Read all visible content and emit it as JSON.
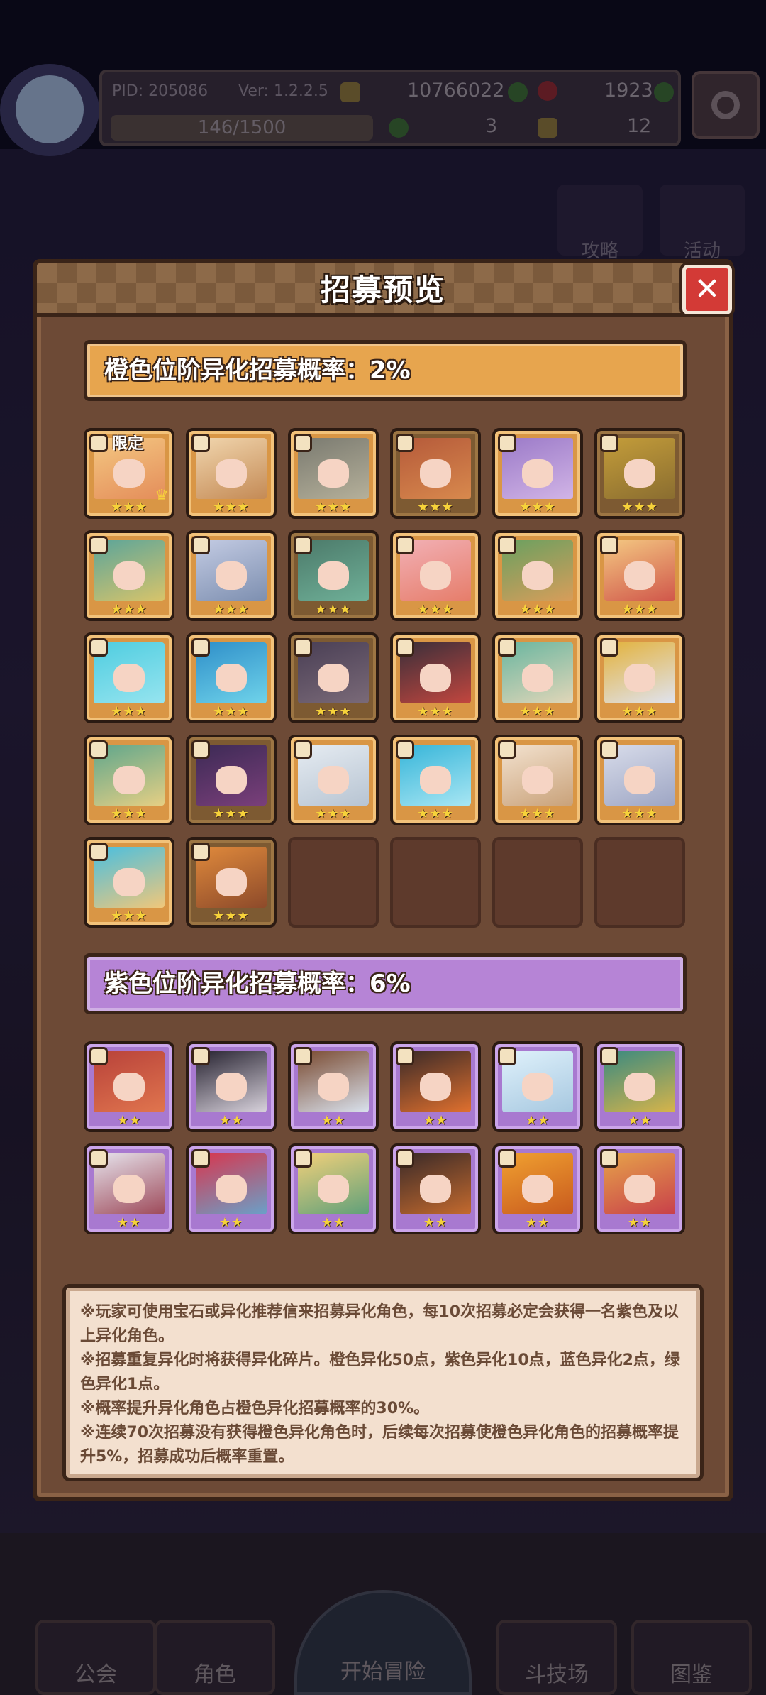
{
  "hud": {
    "pid": "PID: 205086",
    "version": "Ver: 1.2.2.5",
    "gold": "10766022",
    "gems": "1923",
    "xp": "146/1500",
    "clover": "3",
    "tickets": "12"
  },
  "side_buttons": [
    "攻略",
    "活动"
  ],
  "modal": {
    "title": "招募预览",
    "close_icon": "close-icon"
  },
  "orange_section": {
    "label": "橙色位阶异化招募概率：2%",
    "limited_badge": "限定",
    "heroes": [
      {
        "stars": "★★★",
        "active": true,
        "limited": true,
        "colors": [
          "#f4c882",
          "#e48d5a"
        ]
      },
      {
        "stars": "★★★",
        "active": true,
        "colors": [
          "#f1d6ae",
          "#c48a55"
        ]
      },
      {
        "stars": "★★★",
        "active": true,
        "colors": [
          "#7a7a70",
          "#b5b09a"
        ]
      },
      {
        "stars": "★★★",
        "active": false,
        "colors": [
          "#b55a3a",
          "#d8894d"
        ]
      },
      {
        "stars": "★★★",
        "active": true,
        "colors": [
          "#9b7ac8",
          "#d1b4e6"
        ]
      },
      {
        "stars": "★★★",
        "active": false,
        "colors": [
          "#c49d3a",
          "#8a6d30"
        ]
      },
      {
        "stars": "★★★",
        "active": true,
        "colors": [
          "#5ba59a",
          "#d8c46a"
        ]
      },
      {
        "stars": "★★★",
        "active": true,
        "colors": [
          "#c3cbe3",
          "#7d8fb0"
        ]
      },
      {
        "stars": "★★★",
        "active": false,
        "colors": [
          "#4c7a6a",
          "#6fb098"
        ]
      },
      {
        "stars": "★★★",
        "active": true,
        "colors": [
          "#f2b0b5",
          "#e67d6a"
        ]
      },
      {
        "stars": "★★★",
        "active": true,
        "colors": [
          "#6aa060",
          "#d89d5a"
        ]
      },
      {
        "stars": "★★★",
        "active": true,
        "colors": [
          "#f4c882",
          "#d0564a"
        ]
      },
      {
        "stars": "★★★",
        "active": true,
        "colors": [
          "#4fcde0",
          "#96e4ef"
        ]
      },
      {
        "stars": "★★★",
        "active": true,
        "colors": [
          "#2f8fc9",
          "#6fd3ea"
        ]
      },
      {
        "stars": "★★★",
        "active": false,
        "colors": [
          "#4a3f55",
          "#7a6a78"
        ]
      },
      {
        "stars": "★★★",
        "active": true,
        "colors": [
          "#3a2f3a",
          "#c2463e"
        ]
      },
      {
        "stars": "★★★",
        "active": true,
        "colors": [
          "#6ab6a0",
          "#e1d6b8"
        ]
      },
      {
        "stars": "★★★",
        "active": true,
        "colors": [
          "#e3b23c",
          "#dfe3f0"
        ]
      },
      {
        "stars": "★★★",
        "active": true,
        "colors": [
          "#5ea68c",
          "#e5cf84"
        ]
      },
      {
        "stars": "★★★",
        "active": false,
        "colors": [
          "#3c2a55",
          "#7a3f7a"
        ]
      },
      {
        "stars": "★★★",
        "active": true,
        "colors": [
          "#e6ecf2",
          "#b7c4d2"
        ]
      },
      {
        "stars": "★★★",
        "active": true,
        "colors": [
          "#36b5d9",
          "#a7e6f3"
        ]
      },
      {
        "stars": "★★★",
        "active": true,
        "colors": [
          "#f3e2cf",
          "#c9a27a"
        ]
      },
      {
        "stars": "★★★",
        "active": true,
        "colors": [
          "#d8dcea",
          "#9ea6c4"
        ]
      },
      {
        "stars": "★★★",
        "active": true,
        "colors": [
          "#49bfe0",
          "#f0c77a"
        ]
      },
      {
        "stars": "★★★",
        "active": false,
        "colors": [
          "#e08a3c",
          "#8d4a2a"
        ]
      }
    ],
    "empty_slots": 4
  },
  "purple_section": {
    "label": "紫色位阶异化招募概率：6%",
    "heroes": [
      {
        "stars": "★★",
        "colors": [
          "#b8423a",
          "#e0754e"
        ]
      },
      {
        "stars": "★★",
        "colors": [
          "#262230",
          "#d8d2dc"
        ]
      },
      {
        "stars": "★★",
        "colors": [
          "#7a4a30",
          "#d9e2ee"
        ]
      },
      {
        "stars": "★★",
        "colors": [
          "#3a2a28",
          "#e0702e"
        ]
      },
      {
        "stars": "★★",
        "colors": [
          "#dff1fb",
          "#a7c8e0"
        ]
      },
      {
        "stars": "★★",
        "colors": [
          "#3a8a80",
          "#d7b44a"
        ]
      },
      {
        "stars": "★★",
        "colors": [
          "#e6e3ec",
          "#9e4a5a"
        ]
      },
      {
        "stars": "★★",
        "colors": [
          "#d8364e",
          "#6aa0c8"
        ]
      },
      {
        "stars": "★★",
        "colors": [
          "#f2d07a",
          "#5fa07a"
        ]
      },
      {
        "stars": "★★",
        "colors": [
          "#3a2a28",
          "#c46a2e"
        ]
      },
      {
        "stars": "★★",
        "colors": [
          "#f0a030",
          "#c85a1e"
        ]
      },
      {
        "stars": "★★",
        "colors": [
          "#e6a24a",
          "#c8404a"
        ]
      }
    ]
  },
  "notes": [
    "※玩家可使用宝石或异化推荐信来招募异化角色，每10次招募必定会获得一名紫色及以",
    "上异化角色。",
    "※招募重复异化时将获得异化碎片。橙色异化50点，紫色异化10点，蓝色异化2点，绿",
    "色异化1点。",
    "※概率提升异化角色占橙色异化招募概率的30%。",
    "※连续70次招募没有获得橙色异化角色时，后续每次招募使橙色异化角色的招募概率提",
    "升5%，招募成功后概率重置。"
  ],
  "bottom_nav": [
    "公会",
    "角色",
    "开始冒险",
    "斗技场",
    "图鉴"
  ]
}
